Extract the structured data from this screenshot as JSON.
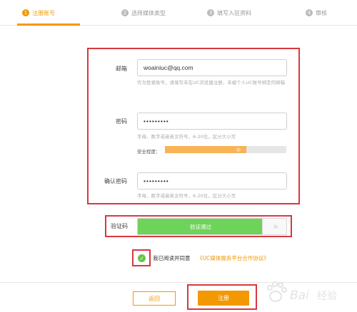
{
  "steps": [
    {
      "num": "1",
      "label": "注册账号",
      "active": true
    },
    {
      "num": "2",
      "label": "选择媒体类型",
      "active": false
    },
    {
      "num": "3",
      "label": "填写入驻资料",
      "active": false
    },
    {
      "num": "4",
      "label": "审核",
      "active": false
    }
  ],
  "form": {
    "email": {
      "label": "邮箱",
      "value": "woainiuc@qq.com",
      "hint": "作为登录账号，请填写未在UC浏览器注册，未被个人UC账号绑定的邮箱"
    },
    "password": {
      "label": "密码",
      "value": "•••••••••",
      "hint": "字母、数字或者英文符号，6-20位，区分大小写",
      "strength_label": "安全程度：",
      "strength_text": "中",
      "strength_percent": 67
    },
    "confirm": {
      "label": "确认密码",
      "value": "•••••••••",
      "hint": "字母、数字或者英文符号，6-20位，区分大小写"
    }
  },
  "captcha": {
    "label": "验证码",
    "status": "验证通过",
    "handle": "»"
  },
  "agreement": {
    "text": "我已阅读并同意",
    "link": "《UC媒体服务平台合作协议》",
    "checked": true
  },
  "buttons": {
    "back": "返回",
    "register": "注册"
  },
  "colors": {
    "accent": "#f39800",
    "success": "#6ed35a",
    "annotation_red": "#d8383f"
  }
}
